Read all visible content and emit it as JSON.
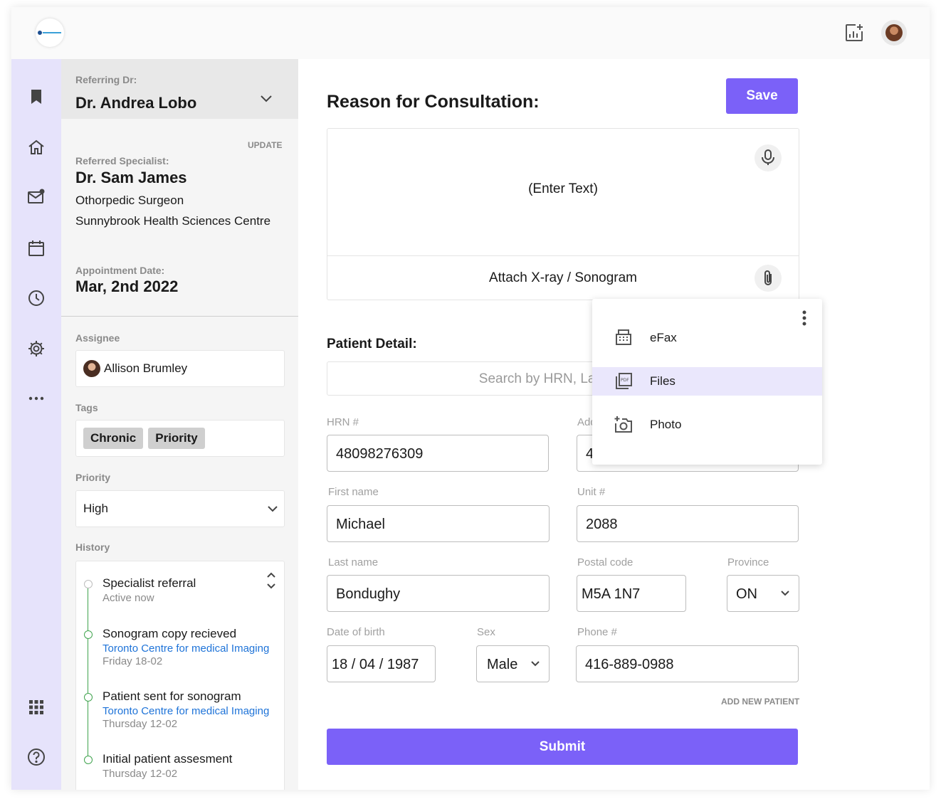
{
  "referral": {
    "referring_label": "Referring Dr:",
    "referring_name": "Dr. Andrea Lobo",
    "update_label": "UPDATE",
    "specialist_label": "Referred Specialist:",
    "specialist_name": "Dr. Sam James",
    "specialist_title": "Othorpedic Surgeon",
    "specialist_org": "Sunnybrook Health Sciences Centre",
    "appt_label": "Appointment Date:",
    "appt_date": "Mar, 2nd 2022"
  },
  "assignee": {
    "label": "Assignee",
    "name": "Allison Brumley"
  },
  "tags": {
    "label": "Tags",
    "items": [
      "Chronic",
      "Priority"
    ]
  },
  "priority": {
    "label": "Priority",
    "value": "High"
  },
  "history": {
    "label": "History",
    "items": [
      {
        "title": "Specialist referral",
        "link": "",
        "date": "Active now"
      },
      {
        "title": "Sonogram copy recieved",
        "link": "Toronto Centre for medical Imaging",
        "date": "Friday 18-02"
      },
      {
        "title": "Patient sent for sonogram",
        "link": "Toronto Centre for medical Imaging",
        "date": "Thursday 12-02"
      },
      {
        "title": "Initial patient assesment",
        "link": "",
        "date": "Thursday 12-02"
      }
    ]
  },
  "consult": {
    "title": "Reason for Consultation:",
    "save_label": "Save",
    "enter_text": "(Enter Text)",
    "attach_label": "Attach X-ray / Sonogram"
  },
  "attach_menu": {
    "items": [
      "eFax",
      "Files",
      "Photo"
    ],
    "selected": "Files"
  },
  "patient": {
    "title": "Patient Detail:",
    "search_placeholder": "Search by HRN, Last Name",
    "hrn_label": "HRN #",
    "hrn": "48098276309",
    "address_label": "Address",
    "address": "4",
    "first_label": "First name",
    "first": "Michael",
    "unit_label": "Unit #",
    "unit": "2088",
    "last_label": "Last name",
    "last": "Bondughy",
    "postal_label": "Postal code",
    "postal": "M5A 1N7",
    "province_label": "Province",
    "province": "ON",
    "dob_label": "Date of birth",
    "dob": "18 / 04 / 1987",
    "sex_label": "Sex",
    "sex": "Male",
    "phone_label": "Phone #",
    "phone": "416-889-0988",
    "add_new": "ADD NEW PATIENT",
    "submit_label": "Submit"
  },
  "colors": {
    "accent": "#7b61f8",
    "rail": "#e6e3fb",
    "link": "#1e73d8",
    "timeline": "#3fa34d"
  }
}
